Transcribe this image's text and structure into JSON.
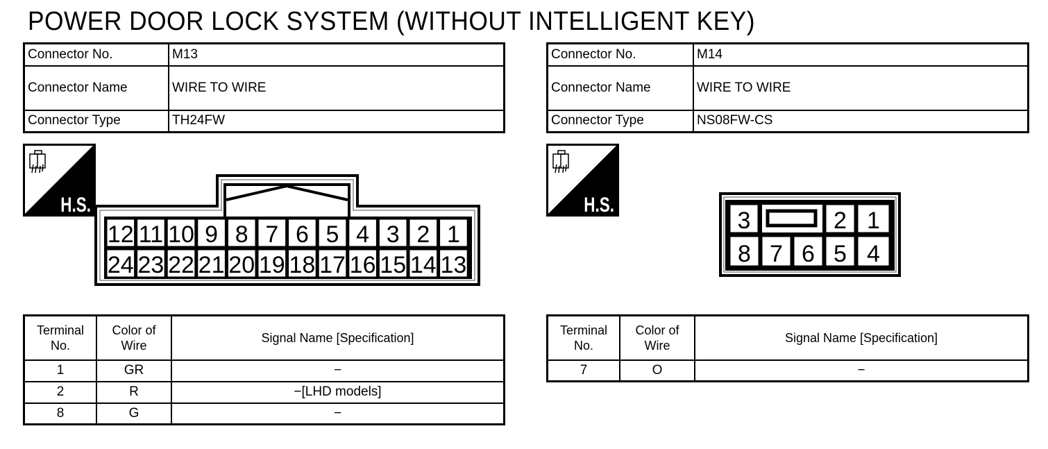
{
  "title": "POWER DOOR LOCK SYSTEM (WITHOUT INTELLIGENT KEY)",
  "connectors": [
    {
      "no_label": "Connector No.",
      "no": "M13",
      "name_label": "Connector Name",
      "name": "WIRE TO WIRE",
      "type_label": "Connector Type",
      "type": "TH24FW",
      "icon": "harness-side-icon",
      "icon_text": "H.S.",
      "pins_row1": [
        "12",
        "11",
        "10",
        "9",
        "8",
        "7",
        "6",
        "5",
        "4",
        "3",
        "2",
        "1"
      ],
      "pins_row2": [
        "24",
        "23",
        "22",
        "21",
        "20",
        "19",
        "18",
        "17",
        "16",
        "15",
        "14",
        "13"
      ],
      "table": {
        "headers": [
          "Terminal No.",
          "Color of Wire",
          "Signal Name [Specification]"
        ],
        "rows": [
          [
            "1",
            "GR",
            "−"
          ],
          [
            "2",
            "R",
            "−[LHD models]"
          ],
          [
            "8",
            "G",
            "−"
          ]
        ]
      }
    },
    {
      "no_label": "Connector No.",
      "no": "M14",
      "name_label": "Connector Name",
      "name": "WIRE TO WIRE",
      "type_label": "Connector Type",
      "type": "NS08FW-CS",
      "icon": "harness-side-icon",
      "icon_text": "H.S.",
      "pins_row1": [
        "3",
        "2",
        "1"
      ],
      "pins_row2": [
        "8",
        "7",
        "6",
        "5",
        "4"
      ],
      "table": {
        "headers": [
          "Terminal No.",
          "Color of Wire",
          "Signal Name [Specification]"
        ],
        "rows": [
          [
            "7",
            "O",
            "−"
          ]
        ]
      }
    }
  ]
}
